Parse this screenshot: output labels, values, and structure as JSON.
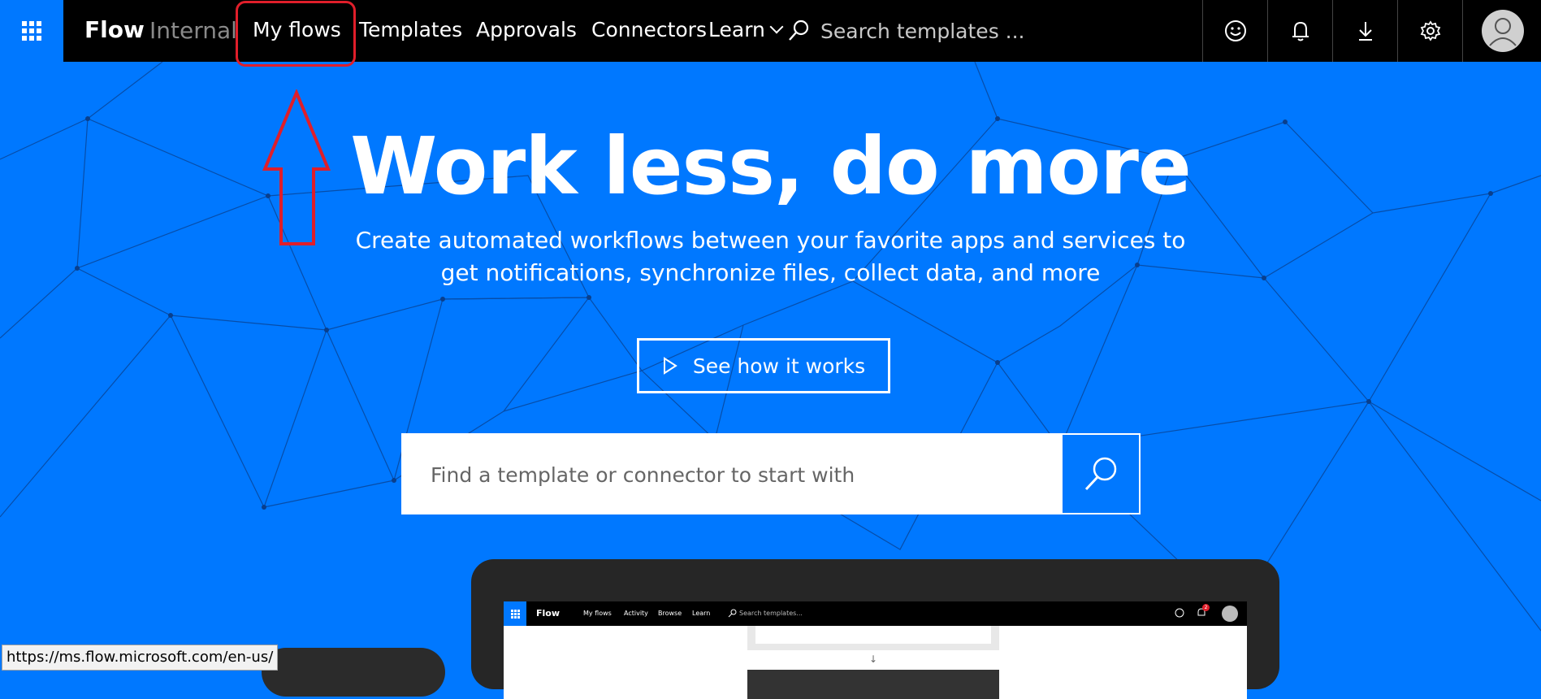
{
  "app": {
    "brand": "Flow",
    "environment": "Internal"
  },
  "nav": {
    "items": [
      "My flows",
      "Templates",
      "Approvals",
      "Connectors",
      "Learn"
    ],
    "search_placeholder": "Search templates ..."
  },
  "top_icons": [
    "smiley-icon",
    "bell-icon",
    "download-icon",
    "gear-icon",
    "avatar"
  ],
  "hero": {
    "title": "Work less, do more",
    "subtitle": "Create automated workflows between your favorite apps and services to get notifications, synchronize files, collect data, and more",
    "cta_label": "See how it works",
    "search_placeholder": "Find a template or connector to start with"
  },
  "preview": {
    "brand": "Flow",
    "nav": [
      "My flows",
      "Activity",
      "Browse",
      "Learn"
    ],
    "search_placeholder": "Search templates...",
    "notification_count": "2"
  },
  "status_bar": {
    "url": "https://ms.flow.microsoft.com/en-us/"
  },
  "colors": {
    "accent": "#0078ff",
    "topbar": "#000000",
    "annotation": "#e01e2a"
  }
}
